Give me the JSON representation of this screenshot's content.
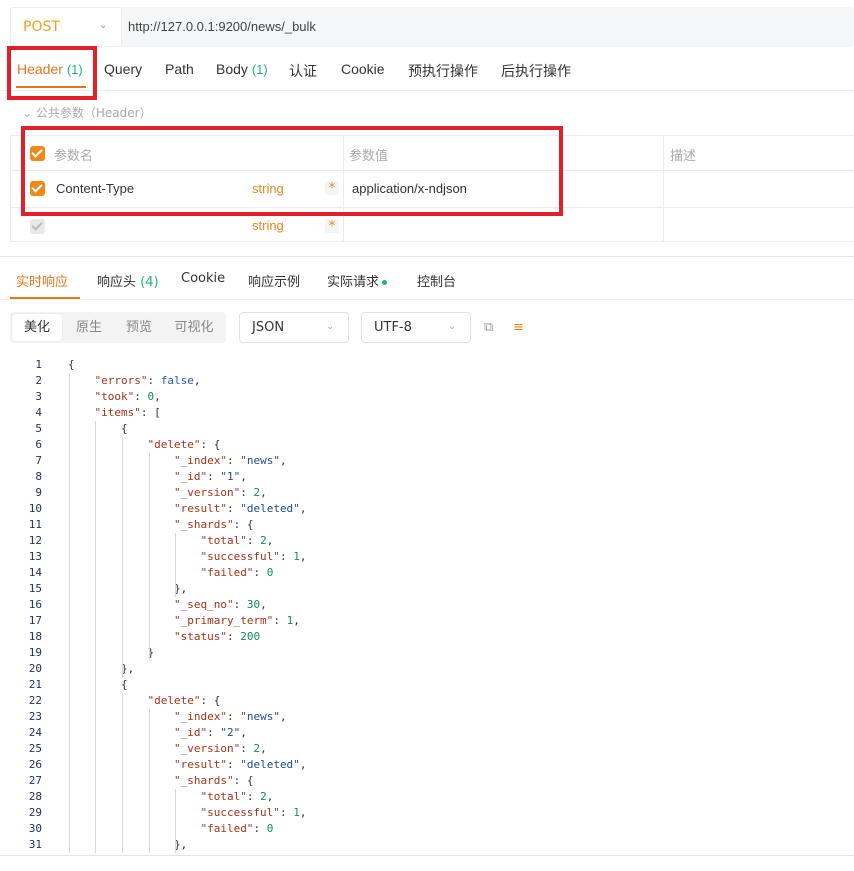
{
  "request": {
    "method": "POST",
    "url": "http://127.0.0.1:9200/news/_bulk",
    "tabs": [
      {
        "label": "Header",
        "count": "(1)"
      },
      {
        "label": "Query"
      },
      {
        "label": "Path"
      },
      {
        "label": "Body",
        "count": "(1)"
      },
      {
        "label": "认证"
      },
      {
        "label": "Cookie"
      },
      {
        "label": "预执行操作"
      },
      {
        "label": "后执行操作"
      }
    ]
  },
  "headers": {
    "common_label": "公共参数（Header）",
    "columns": {
      "name": "参数名",
      "value": "参数值",
      "desc": "描述"
    },
    "rows": [
      {
        "name": "Content-Type",
        "type": "string",
        "required": "*",
        "value": "application/x-ndjson"
      },
      {
        "name": "",
        "type": "string",
        "required": "*",
        "value": ""
      }
    ]
  },
  "response": {
    "tabs": [
      {
        "label": "实时响应"
      },
      {
        "label": "响应头",
        "count": "(4)"
      },
      {
        "label": "Cookie"
      },
      {
        "label": "响应示例"
      },
      {
        "label": "实际请求"
      },
      {
        "label": "控制台"
      }
    ],
    "views": [
      "美化",
      "原生",
      "预览",
      "可视化"
    ],
    "format": "JSON",
    "encoding": "UTF-8",
    "code_lines": [
      "{",
      "    \"errors\": false,",
      "    \"took\": 0,",
      "    \"items\": [",
      "        {",
      "            \"delete\": {",
      "                \"_index\": \"news\",",
      "                \"_id\": \"1\",",
      "                \"_version\": 2,",
      "                \"result\": \"deleted\",",
      "                \"_shards\": {",
      "                    \"total\": 2,",
      "                    \"successful\": 1,",
      "                    \"failed\": 0",
      "                },",
      "                \"_seq_no\": 30,",
      "                \"_primary_term\": 1,",
      "                \"status\": 200",
      "            }",
      "        },",
      "        {",
      "            \"delete\": {",
      "                \"_index\": \"news\",",
      "                \"_id\": \"2\",",
      "                \"_version\": 2,",
      "                \"result\": \"deleted\",",
      "                \"_shards\": {",
      "                    \"total\": 2,",
      "                    \"successful\": 1,",
      "                    \"failed\": 0",
      "                },"
    ]
  },
  "colors": {
    "accent": "#e8761c",
    "count_green": "#22b37a",
    "highlight_red": "#e1202b"
  }
}
